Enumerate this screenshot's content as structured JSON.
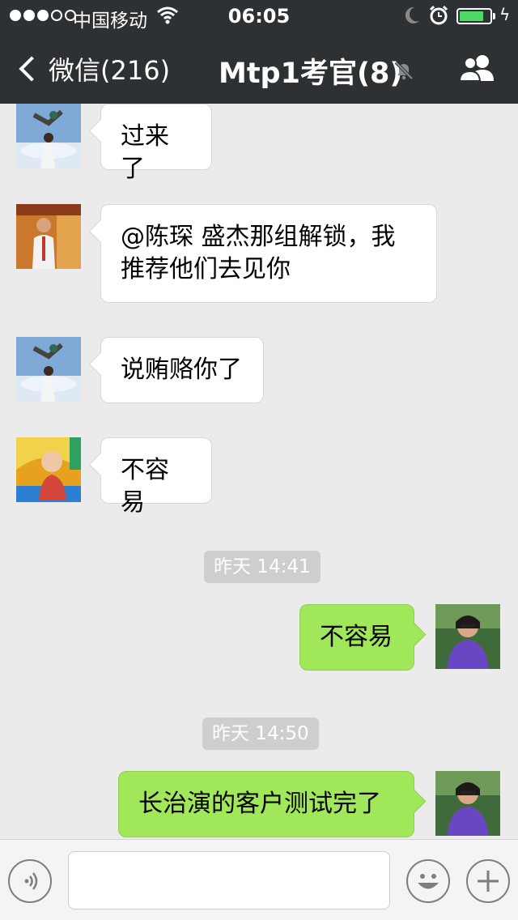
{
  "status_bar": {
    "carrier": "中国移动",
    "time": "06:05",
    "battery_level": 0.8,
    "signal_bars_filled": 3,
    "signal_bars_total": 5
  },
  "nav": {
    "back_label": "微信(216)",
    "title": "Mtp1考官(8)",
    "icons": [
      "chevron-left-icon",
      "mute-bell-icon",
      "group-contacts-icon"
    ]
  },
  "messages": [
    {
      "direction": "in",
      "text": "过来了"
    },
    {
      "direction": "in",
      "text_lines": [
        "@陈琛 盛杰那组解锁，我",
        "推荐他们去见你"
      ]
    },
    {
      "direction": "in",
      "text": "说贿赂你了"
    },
    {
      "direction": "in",
      "text": "不容易"
    },
    {
      "type": "timestamp",
      "text": "昨天 14:41"
    },
    {
      "direction": "out",
      "text": "不容易"
    },
    {
      "type": "timestamp",
      "text": "昨天 14:50"
    },
    {
      "direction": "out",
      "text": "长治演的客户测试完了"
    }
  ],
  "input_bar": {
    "icons": [
      "voice-icon",
      "emoji-icon",
      "plus-icon"
    ]
  },
  "colors": {
    "nav_bg": "#2e3134",
    "chat_bg": "#ebebeb",
    "outgoing_bubble": "#a0e75a",
    "incoming_bubble": "#ffffff",
    "battery_green": "#4cd964"
  }
}
